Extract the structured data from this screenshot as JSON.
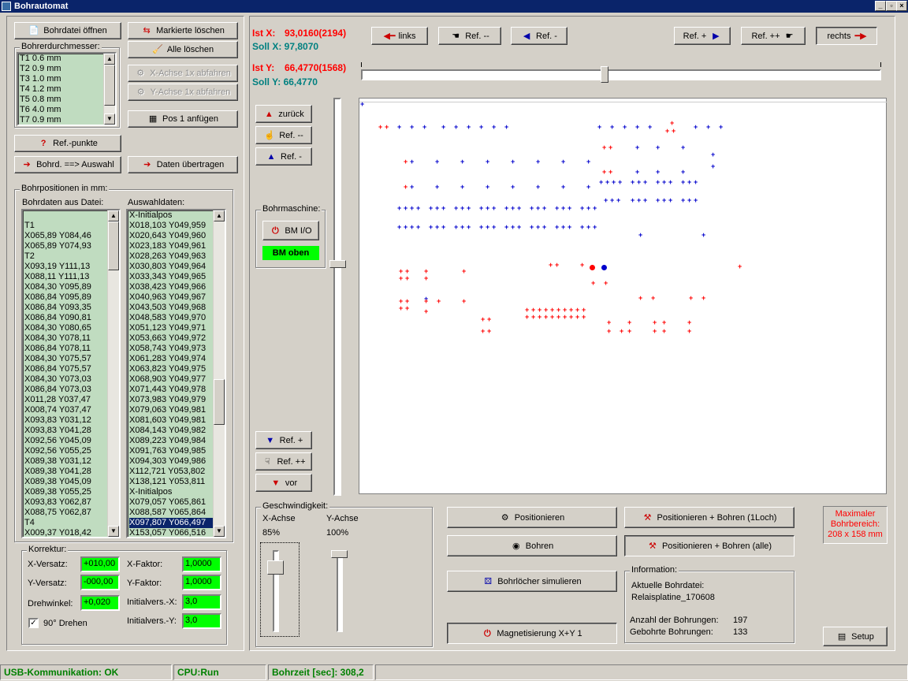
{
  "window": {
    "title": "Bohrautomat",
    "min": "_",
    "max": "▫",
    "close": "×"
  },
  "left_buttons": {
    "open": "Bohrdatei öffnen",
    "clear_marked": "Markierte löschen",
    "clear_all": "Alle löschen",
    "x_axis": "X-Achse 1x abfahren",
    "y_axis": "Y-Achse 1x abfahren",
    "pos1": "Pos 1 anfügen",
    "refpoints": "Ref.-punkte",
    "bohrd_auswahl": "Bohrd. ==> Auswahl",
    "transfer": "Daten übertragen"
  },
  "drill_diameter": {
    "label": "Bohrerdurchmesser:",
    "items": [
      "T1 0.6 mm",
      "T2 0.9 mm",
      "T3 1.0 mm",
      "T4 1.2 mm",
      "T5 0.8 mm",
      "T6 4.0 mm",
      "T7 0.9 mm"
    ]
  },
  "positions": {
    "label": "Bohrpositionen in mm:",
    "file_label": "Bohrdaten aus Datei:",
    "sel_label": "Auswahldaten:",
    "file_items": [
      "",
      "T1",
      "X065,89 Y084,46",
      "X065,89 Y074,93",
      "T2",
      "X093,19 Y111,13",
      "X088,11 Y111,13",
      "X084,30 Y095,89",
      "X086,84 Y095,89",
      "X086,84 Y093,35",
      "X086,84 Y090,81",
      "X084,30 Y080,65",
      "X084,30 Y078,11",
      "X086,84 Y078,11",
      "X084,30 Y075,57",
      "X086,84 Y075,57",
      "X084,30 Y073,03",
      "X086,84 Y073,03",
      "X011,28 Y037,47",
      "X008,74 Y037,47",
      "X093,83 Y031,12",
      "X093,83 Y041,28",
      "X092,56 Y045,09",
      "X092,56 Y055,25",
      "X089,38 Y031,12",
      "X089,38 Y041,28",
      "X089,38 Y045,09",
      "X089,38 Y055,25",
      "X093,83 Y062,87",
      "X088,75 Y062,87",
      "T4",
      "X009,37 Y018,42"
    ],
    "sel_items": [
      "X-Initialpos",
      "X018,103 Y049,959",
      "X020,643 Y049,960",
      "X023,183 Y049,961",
      "X028,263 Y049,963",
      "X030,803 Y049,964",
      "X033,343 Y049,965",
      "X038,423 Y049,966",
      "X040,963 Y049,967",
      "X043,503 Y049,968",
      "X048,583 Y049,970",
      "X051,123 Y049,971",
      "X053,663 Y049,972",
      "X058,743 Y049,973",
      "X061,283 Y049,974",
      "X063,823 Y049,975",
      "X068,903 Y049,977",
      "X071,443 Y049,978",
      "X073,983 Y049,979",
      "X079,063 Y049,981",
      "X081,603 Y049,981",
      "X084,143 Y049,982",
      "X089,223 Y049,984",
      "X091,763 Y049,985",
      "X094,303 Y049,986",
      "X112,721 Y053,802",
      "X138,121 Y053,811",
      "X-Initialpos",
      "X079,057 Y065,861",
      "X088,587 Y065,864",
      "X097,807 Y066,497",
      "X153,057 Y066,516"
    ],
    "selected_index": 30
  },
  "correction": {
    "label": "Korrektur:",
    "x_offset_label": "X-Versatz:",
    "x_offset": "+010,00",
    "y_offset_label": "Y-Versatz:",
    "y_offset": "-000,00",
    "rot_label": "Drehwinkel:",
    "rot": "+0,020",
    "x_factor_label": "X-Faktor:",
    "x_factor": "1,0000",
    "y_factor_label": "Y-Faktor:",
    "y_factor": "1,0000",
    "init_x_label": "Initialvers.-X:",
    "init_x": "3,0",
    "init_y_label": "Initialvers.-Y:",
    "init_y": "3,0",
    "rotate90": "90° Drehen"
  },
  "coords": {
    "ist_x": "Ist X:",
    "ist_x_val": "93,0160(2194)",
    "soll_x": "Soll X: 97,8070",
    "ist_y": "Ist Y:",
    "ist_y_val": "66,4770(1568)",
    "soll_y": "Soll Y: 66,4770"
  },
  "nav": {
    "links": "links",
    "ref_mm": "Ref. --",
    "ref_m": "Ref. -",
    "ref_p": "Ref. +",
    "ref_pp": "Ref. ++",
    "rechts": "rechts",
    "zurueck": "zurück",
    "vref_mm": "Ref. --",
    "vref_m": "Ref. -",
    "vref_p": "Ref. +",
    "vref_pp": "Ref. ++",
    "vor": "vor"
  },
  "machine": {
    "label": "Bohrmaschine:",
    "io": "BM I/O",
    "status": "BM oben",
    "status_color": "#00ff00"
  },
  "speed": {
    "label": "Geschwindigkeit:",
    "x_label": "X-Achse",
    "y_label": "Y-Achse",
    "x_val": "85%",
    "y_val": "100%",
    "x_level": 0.85,
    "y_level": 1.0
  },
  "actions": {
    "position": "Positionieren",
    "pos_drill_one": "Positionieren + Bohren (1Loch)",
    "drill": "Bohren",
    "pos_drill_all": "Positionieren + Bohren (alle)",
    "simulate": "Bohrlöcher simulieren",
    "magnet": "Magnetisierung X+Y 1"
  },
  "max_area": {
    "l1": "Maximaler",
    "l2": "Bohrbereich:",
    "l3": "208 x 158 mm"
  },
  "info": {
    "label": "Information:",
    "cur_file_label": "Aktuelle Bohrdatei:",
    "cur_file": "Relaisplatine_170608",
    "count_label": "Anzahl der Bohrungen:",
    "count": "197",
    "done_label": "Gebohrte Bohrungen:",
    "done": "133"
  },
  "setup": "Setup",
  "status": {
    "usb": "USB-Kommunikation: OK",
    "cpu": "CPU:Run",
    "time": "Bohrzeit [sec]: 308,2"
  }
}
